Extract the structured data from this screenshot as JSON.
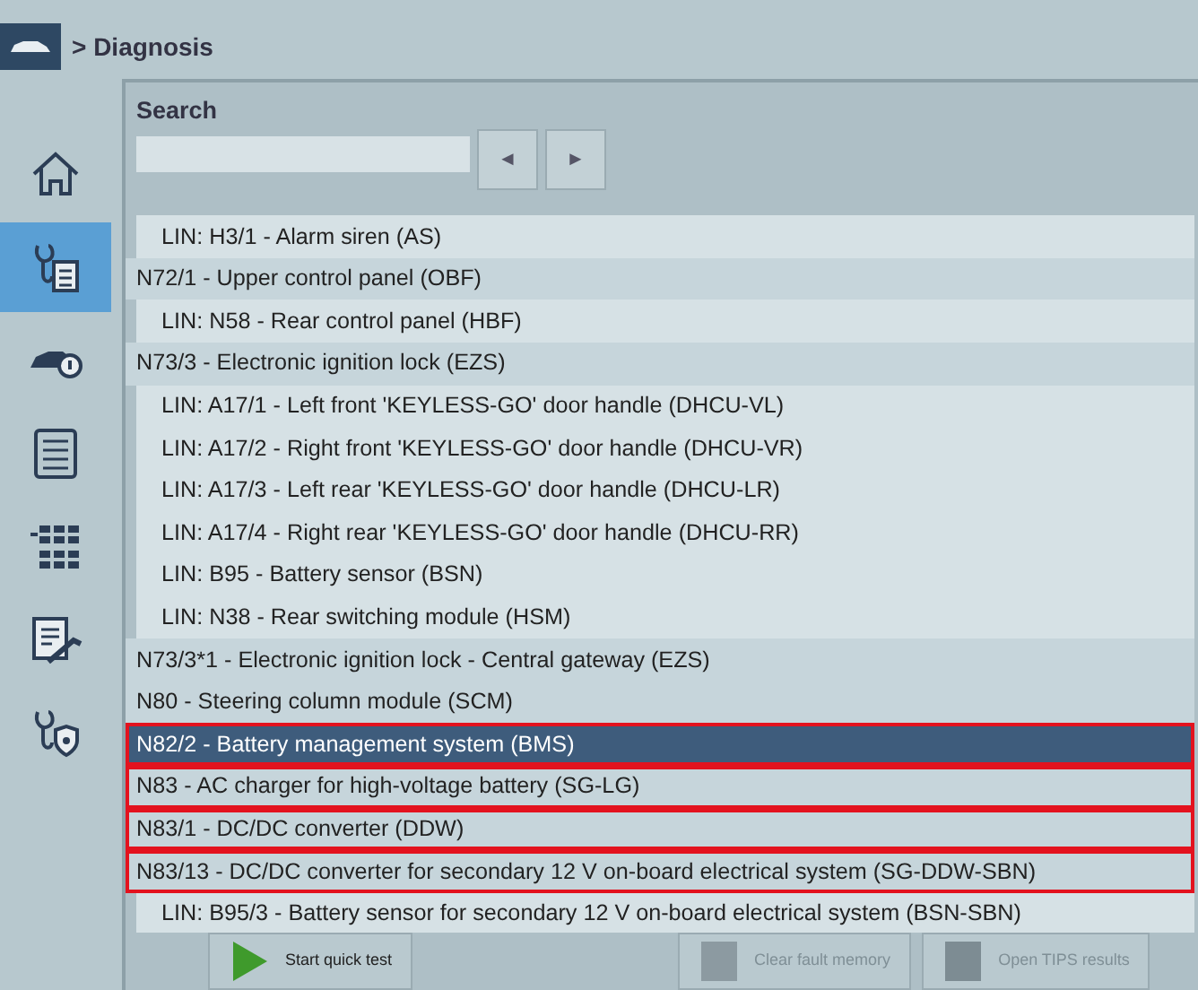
{
  "header": {
    "breadcrumb": "> Diagnosis"
  },
  "sidebar": {
    "items": [
      {
        "selected": false
      },
      {
        "selected": true
      },
      {
        "selected": false
      },
      {
        "selected": false
      },
      {
        "selected": false
      },
      {
        "selected": false
      },
      {
        "selected": false
      }
    ]
  },
  "search": {
    "label": "Search",
    "prev": "◄",
    "next": "►"
  },
  "modules": [
    {
      "children": [
        {
          "label": "LIN: H3/1 - Alarm siren (AS)",
          "selected": false,
          "highlighted": false
        }
      ]
    },
    {
      "label": "N72/1 - Upper control panel (OBF)",
      "selected": false,
      "highlighted": false,
      "children": [
        {
          "label": "LIN: N58 - Rear control panel (HBF)",
          "selected": false,
          "highlighted": false
        }
      ]
    },
    {
      "label": "N73/3 - Electronic ignition lock (EZS)",
      "selected": false,
      "highlighted": false,
      "children": [
        {
          "label": "LIN: A17/1 - Left front 'KEYLESS-GO' door handle (DHCU-VL)",
          "selected": false,
          "highlighted": false
        },
        {
          "label": "LIN: A17/2 - Right front 'KEYLESS-GO' door handle (DHCU-VR)",
          "selected": false,
          "highlighted": false
        },
        {
          "label": "LIN: A17/3 - Left rear 'KEYLESS-GO' door handle (DHCU-LR)",
          "selected": false,
          "highlighted": false
        },
        {
          "label": "LIN: A17/4 - Right rear 'KEYLESS-GO' door handle (DHCU-RR)",
          "selected": false,
          "highlighted": false
        },
        {
          "label": "LIN: B95 - Battery sensor (BSN)",
          "selected": false,
          "highlighted": false
        },
        {
          "label": "LIN: N38 - Rear switching module (HSM)",
          "selected": false,
          "highlighted": false
        }
      ]
    },
    {
      "label": "N73/3*1 - Electronic ignition lock - Central gateway (EZS)",
      "selected": false,
      "highlighted": false
    },
    {
      "label": "N80 - Steering column module (SCM)",
      "selected": false,
      "highlighted": false
    },
    {
      "label": "N82/2 - Battery management system (BMS)",
      "selected": true,
      "highlighted": true
    },
    {
      "label": "N83 - AC charger for high-voltage battery (SG-LG)",
      "selected": false,
      "highlighted": true
    },
    {
      "label": "N83/1 - DC/DC converter (DDW)",
      "selected": false,
      "highlighted": true
    },
    {
      "label": "N83/13 - DC/DC converter for secondary 12 V on-board electrical system (SG-DDW-SBN)",
      "selected": false,
      "highlighted": true,
      "children": [
        {
          "label": "LIN: B95/3 - Battery sensor for secondary 12 V on-board electrical system (BSN-SBN)",
          "selected": false,
          "highlighted": false
        }
      ]
    }
  ],
  "toolbar": [
    {
      "label": "Start quick test",
      "disabled": false
    },
    {
      "label": "Clear fault memory",
      "disabled": true
    },
    {
      "label": "Open TIPS results",
      "disabled": true
    }
  ]
}
